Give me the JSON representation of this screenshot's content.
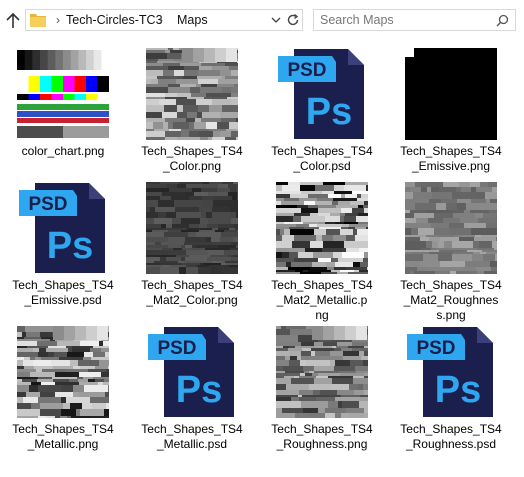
{
  "navigation": {
    "up_icon": "arrow-up-icon",
    "breadcrumb": [
      "Tech-Circles-TC3",
      "Maps"
    ],
    "refresh_icon": "refresh-icon"
  },
  "search": {
    "placeholder": "Search Maps"
  },
  "files": [
    {
      "name": "color_chart.png",
      "label_lines": [
        "color_chart.png"
      ],
      "kind": "color-chart"
    },
    {
      "name": "Tech_Shapes_TS4_Color.png",
      "label_lines": [
        "Tech_Shapes_TS4",
        "_Color.png"
      ],
      "kind": "texture-light"
    },
    {
      "name": "Tech_Shapes_TS4_Color.psd",
      "label_lines": [
        "Tech_Shapes_TS4",
        "_Color.psd"
      ],
      "kind": "psd"
    },
    {
      "name": "Tech_Shapes_TS4_Emissive.png",
      "label_lines": [
        "Tech_Shapes_TS4",
        "_Emissive.png"
      ],
      "kind": "black"
    },
    {
      "name": "Tech_Shapes_TS4_Emissive.psd",
      "label_lines": [
        "Tech_Shapes_TS4",
        "_Emissive.psd"
      ],
      "kind": "psd"
    },
    {
      "name": "Tech_Shapes_TS4_Mat2_Color.png",
      "label_lines": [
        "Tech_Shapes_TS4",
        "_Mat2_Color.png"
      ],
      "kind": "texture-dark"
    },
    {
      "name": "Tech_Shapes_TS4_Mat2_Metallic.png",
      "label_lines": [
        "Tech_Shapes_TS4",
        "_Mat2_Metallic.p",
        "ng"
      ],
      "kind": "texture-bw"
    },
    {
      "name": "Tech_Shapes_TS4_Mat2_Roughness.png",
      "label_lines": [
        "Tech_Shapes_TS4",
        "_Mat2_Roughnes",
        "s.png"
      ],
      "kind": "texture-mid"
    },
    {
      "name": "Tech_Shapes_TS4_Metallic.png",
      "label_lines": [
        "Tech_Shapes_TS4",
        "_Metallic.png"
      ],
      "kind": "texture-metal"
    },
    {
      "name": "Tech_Shapes_TS4_Metallic.psd",
      "label_lines": [
        "Tech_Shapes_TS4",
        "_Metallic.psd"
      ],
      "kind": "psd"
    },
    {
      "name": "Tech_Shapes_TS4_Roughness.png",
      "label_lines": [
        "Tech_Shapes_TS4",
        "_Roughness.png"
      ],
      "kind": "texture-rough"
    },
    {
      "name": "Tech_Shapes_TS4_Roughness.psd",
      "label_lines": [
        "Tech_Shapes_TS4",
        "_Roughness.psd"
      ],
      "kind": "psd"
    }
  ],
  "psd_icon": {
    "badge": "PSD",
    "mark": "Ps",
    "bg": "#1b1f4d",
    "accent": "#2fa7f0"
  },
  "colors": {
    "folder": "#f3c84b",
    "border": "#d9d9d9"
  }
}
